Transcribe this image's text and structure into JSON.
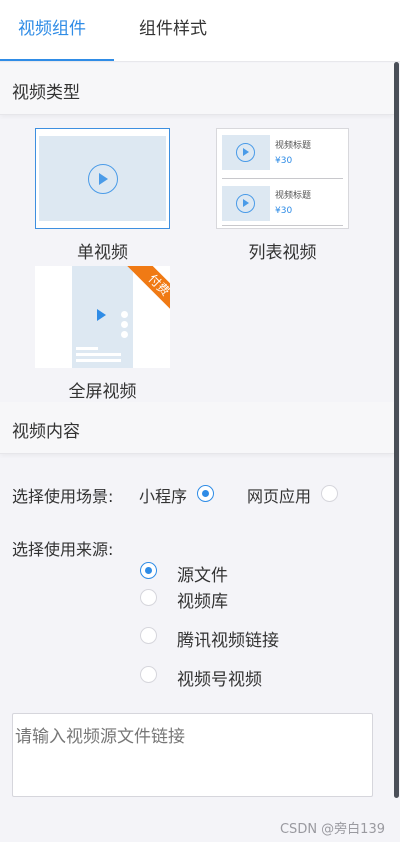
{
  "tabs": [
    {
      "label": "视频组件",
      "active": true
    },
    {
      "label": "组件样式",
      "active": false
    }
  ],
  "sections": {
    "video_type": "视频类型",
    "video_content": "视频内容"
  },
  "video_types": [
    {
      "label": "单视频",
      "selected": true
    },
    {
      "label": "列表视频",
      "selected": false
    },
    {
      "label": "全屏视频",
      "selected": false,
      "badge": "付费"
    }
  ],
  "list_preview": {
    "items": [
      {
        "title": "视频标题",
        "price": "¥30"
      },
      {
        "title": "视频标题",
        "price": "¥30"
      }
    ]
  },
  "scene": {
    "label": "选择使用场景:",
    "options": [
      {
        "label": "小程序",
        "checked": true
      },
      {
        "label": "网页应用",
        "checked": false
      }
    ]
  },
  "source": {
    "label": "选择使用来源:",
    "options": [
      {
        "label": "源文件",
        "checked": true
      },
      {
        "label": "视频库",
        "checked": false
      },
      {
        "label": "腾讯视频链接",
        "checked": false
      },
      {
        "label": "视频号视频",
        "checked": false
      }
    ]
  },
  "source_input": {
    "placeholder": "请输入视频源文件链接",
    "value": ""
  },
  "watermark": "CSDN @旁白139",
  "colors": {
    "accent": "#2f8ce6",
    "badge": "#f07a14",
    "preview_bg": "#dde8f2"
  }
}
